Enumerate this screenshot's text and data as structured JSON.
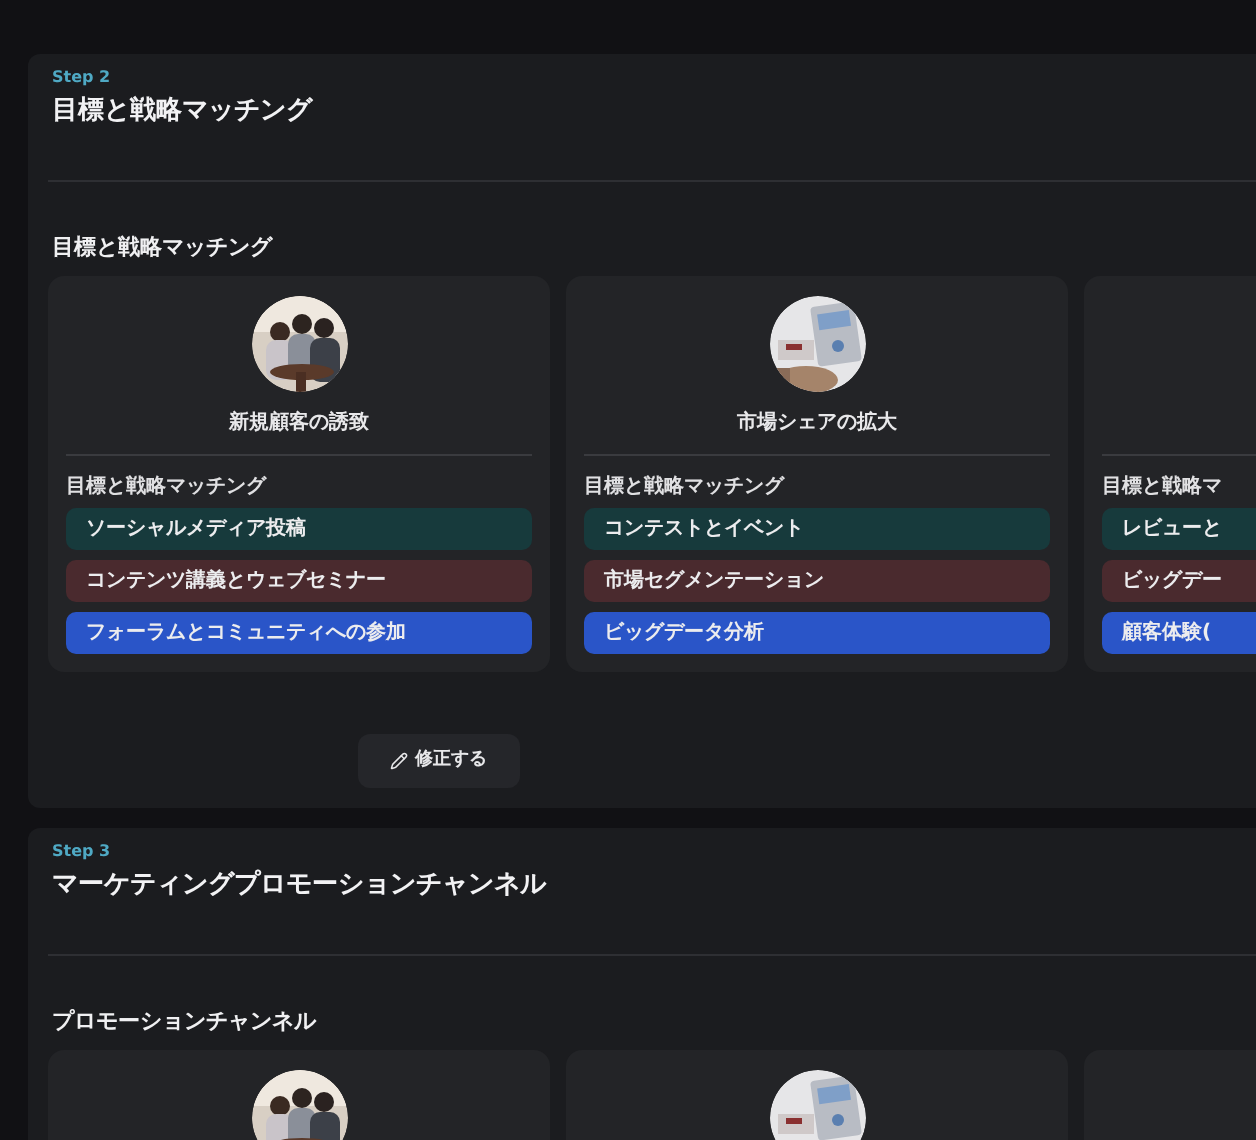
{
  "steps": [
    {
      "step_label": "Step 2",
      "title": "目標と戦略マッチング",
      "subheading": "目標と戦略マッチング",
      "cards": [
        {
          "avatar": {
            "kind": "picture"
          },
          "title": "新規顧客の誘致",
          "section_label": "目標と戦略マッチング",
          "options": [
            {
              "label": "ソーシャルメディア投稿",
              "color": "#173a3c"
            },
            {
              "label": "コンテンツ講義とウェブセミナー",
              "color": "#4a2a2e"
            },
            {
              "label": "フォーラムとコミュニティへの参加",
              "color": "#2a55c8"
            }
          ]
        },
        {
          "avatar": {
            "kind": "picture"
          },
          "title": "市場シェアの拡大",
          "section_label": "目標と戦略マッチング",
          "options": [
            {
              "label": "コンテストとイベント",
              "color": "#173a3c"
            },
            {
              "label": "市場セグメンテーション",
              "color": "#4a2a2e"
            },
            {
              "label": "ビッグデータ分析",
              "color": "#2a55c8"
            }
          ]
        },
        {
          "section_label": "目標と戦略マ",
          "options": [
            {
              "label": "レビューと",
              "color": "#173a3c"
            },
            {
              "label": "ビッグデー",
              "color": "#4a2a2e"
            },
            {
              "label": "顧客体験(",
              "color": "#2a55c8"
            }
          ]
        }
      ],
      "button": "修正する"
    },
    {
      "step_label": "Step 3",
      "title": "マーケティングプロモーションチャンネル",
      "subheading": "プロモーションチャンネル",
      "cards": [
        {
          "avatar": {
            "kind": "picture"
          }
        },
        {
          "avatar": {
            "kind": "picture"
          }
        },
        {
          "kind": "card"
        }
      ]
    }
  ]
}
